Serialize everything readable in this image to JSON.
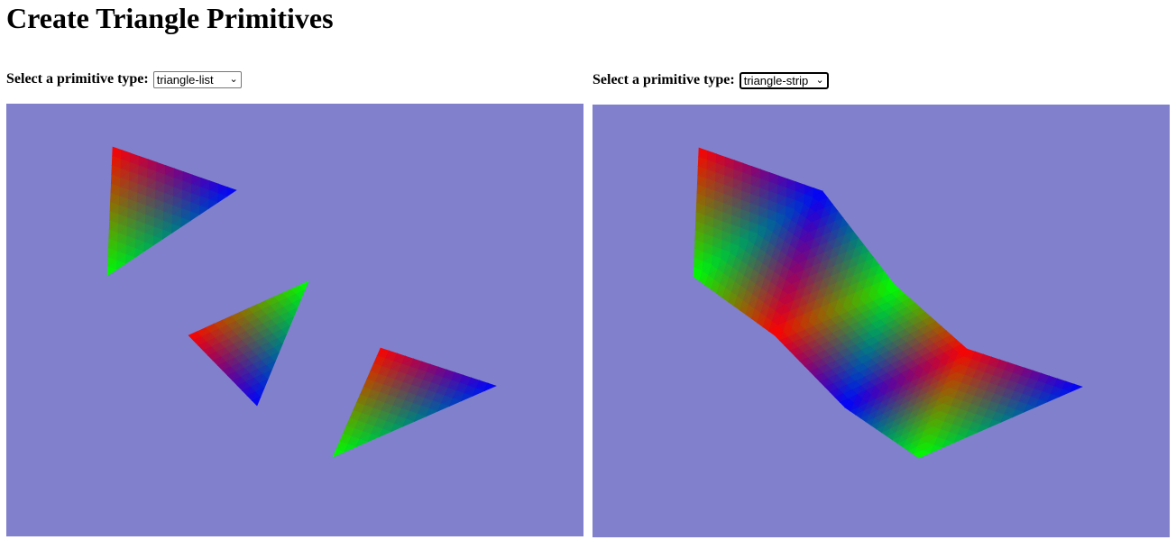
{
  "page": {
    "title": "Create Triangle Primitives"
  },
  "left_panel": {
    "label": "Select a primitive type:",
    "selected": "triangle-list",
    "canvas_bg": "#8080cc"
  },
  "right_panel": {
    "label": "Select a primitive type:",
    "selected": "triangle-strip",
    "canvas_bg": "#8080cc"
  },
  "colors": {
    "red": "#ff0000",
    "green": "#00ff00",
    "blue": "#0000ff"
  }
}
